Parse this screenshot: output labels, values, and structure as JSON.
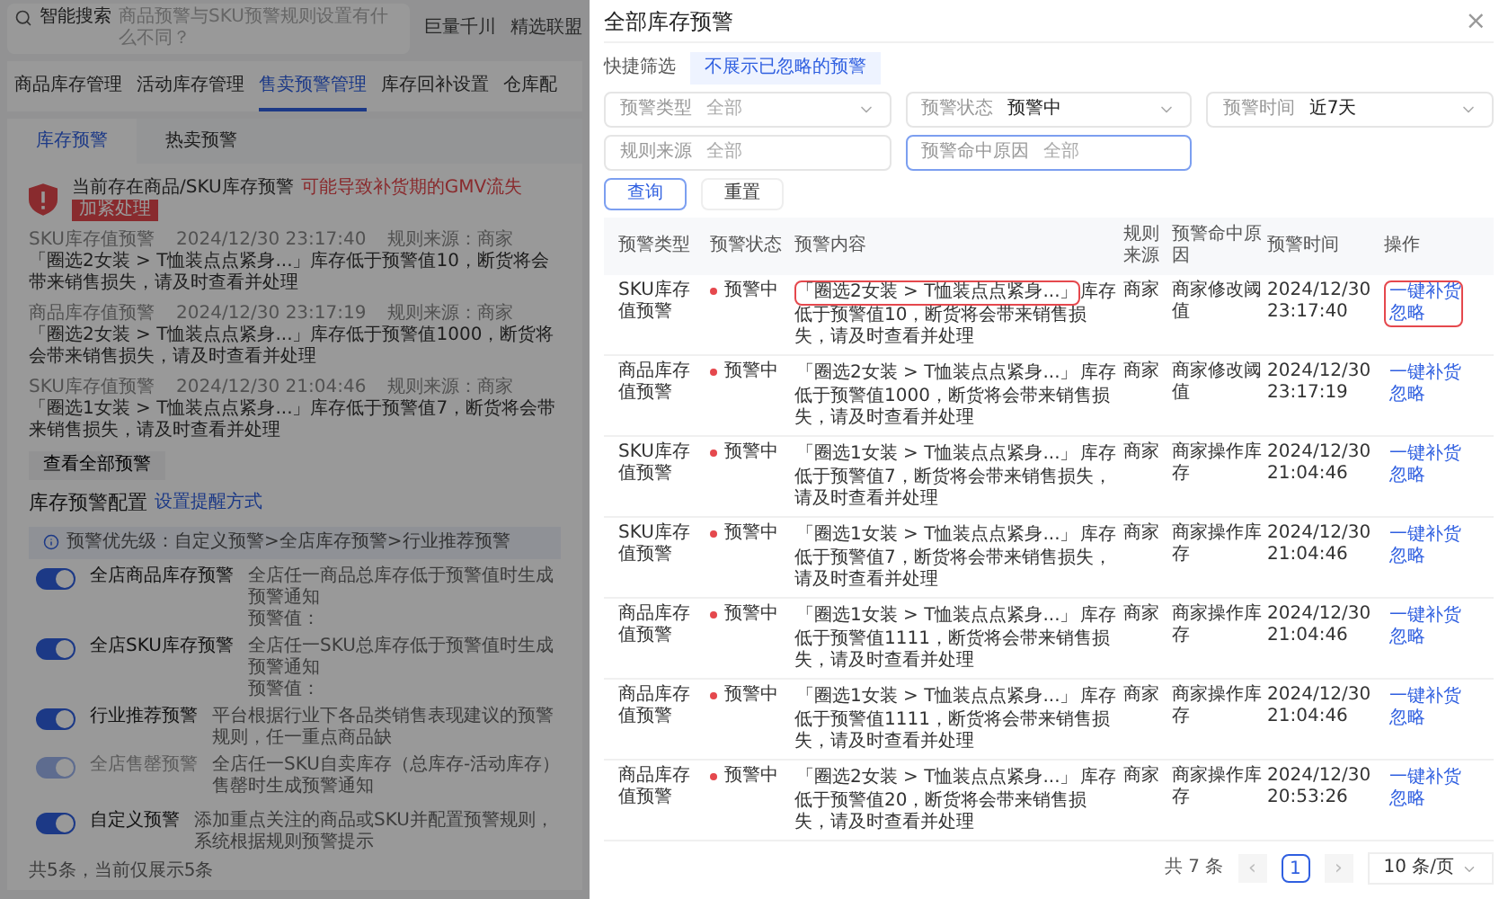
{
  "background": {
    "search": {
      "label": "智能搜索",
      "placeholder": "商品预警与SKU预警规则设置有什么不同？"
    },
    "top_links": [
      "巨量千川",
      "精选联盟"
    ],
    "tabs": [
      {
        "label": "商品库存管理",
        "selected": false
      },
      {
        "label": "活动库存管理",
        "selected": false
      },
      {
        "label": "售卖预警管理",
        "selected": true
      },
      {
        "label": "库存回补设置",
        "selected": false
      },
      {
        "label": "仓库配",
        "selected": false
      }
    ],
    "sub_tabs": [
      {
        "label": "库存预警",
        "selected": true
      },
      {
        "label": "热卖预警",
        "selected": false
      }
    ],
    "alert": {
      "title": "当前存在商品/SKU库存预警",
      "highlight": "可能导致补货期的GMV流失",
      "badge": "加紧处理"
    },
    "alerts": [
      {
        "type": "SKU库存值预警",
        "time": "2024/12/30 23:17:40",
        "source": "规则来源：商家",
        "text": "「圈选2女装 > T恤装点点紧身...」库存低于预警值10，断货将会带来销售损失，请及时查看并处理"
      },
      {
        "type": "商品库存值预警",
        "time": "2024/12/30 23:17:19",
        "source": "规则来源：商家",
        "text": "「圈选2女装 > T恤装点点紧身...」库存低于预警值1000，断货将会带来销售损失，请及时查看并处理"
      },
      {
        "type": "SKU库存值预警",
        "time": "2024/12/30 21:04:46",
        "source": "规则来源：商家",
        "text": "「圈选1女装 > T恤装点点紧身...」库存低于预警值7，断货将会带来销售损失，请及时查看并处理"
      }
    ],
    "view_all": "查看全部预警",
    "config": {
      "title": "库存预警配置",
      "link": "设置提醒方式",
      "notice": "预警优先级：自定义预警>全店库存预警>行业推荐预警"
    },
    "rules": [
      {
        "name": "全店商品库存预警",
        "desc": "全店任一商品总库存低于预警值时生成预警通知",
        "extra": "预警值：",
        "on": true,
        "disabled": false
      },
      {
        "name": "全店SKU库存预警",
        "desc": "全店任一SKU总库存低于预警值时生成预警通知",
        "extra": "预警值：",
        "on": true,
        "disabled": false
      },
      {
        "name": "行业推荐预警",
        "desc": "平台根据行业下各品类销售表现建议的预警规则，任一重点商品缺",
        "on": true,
        "disabled": false
      },
      {
        "name": "全店售罄预警",
        "desc": "全店任一SKU自卖库存（总库存-活动库存）售罄时生成预警通知",
        "on": true,
        "disabled": true
      },
      {
        "name": "自定义预警",
        "desc": "添加重点关注的商品或SKU并配置预警规则，系统根据规则预警提示",
        "on": true,
        "disabled": false
      }
    ],
    "footer": "共5条，当前仅展示5条"
  },
  "drawer": {
    "title": "全部库存预警",
    "close": "×",
    "quick_filter": {
      "label": "快捷筛选",
      "chip": "不展示已忽略的预警"
    },
    "filters": [
      {
        "label": "预警类型",
        "placeholder": "全部",
        "dropdown": true,
        "focused": false
      },
      {
        "label": "预警状态",
        "value": "预警中",
        "dropdown": true,
        "focused": false
      },
      {
        "label": "预警时间",
        "value": "近7天",
        "dropdown": true,
        "focused": false
      },
      {
        "label": "规则来源",
        "placeholder": "全部",
        "dropdown": false,
        "focused": false
      },
      {
        "label": "预警命中原因",
        "placeholder": "全部",
        "dropdown": false,
        "focused": true
      }
    ],
    "buttons": [
      {
        "label": "查询",
        "kind": "primary"
      },
      {
        "label": "重置",
        "kind": "default"
      }
    ],
    "table": {
      "columns": [
        "预警类型",
        "预警状态",
        "预警内容",
        "规则来源",
        "预警命中原因",
        "预警时间",
        "操作"
      ],
      "rows": [
        {
          "type": "SKU库存值预警",
          "status": "预警中",
          "product": "「圈选2女装 > T恤装点点紧身...」",
          "text": "库存低于预警值10，断货将会带来销售损失，请及时查看并处理",
          "source": "商家",
          "reason": "商家修改阈值",
          "date": "2024/12/30",
          "time": "23:17:40",
          "actions": [
            "一键补货",
            "忽略"
          ],
          "highlighted": true
        },
        {
          "type": "商品库存值预警",
          "status": "预警中",
          "product": "「圈选2女装 > T恤装点点紧身...」",
          "text": "库存低于预警值1000，断货将会带来销售损失，请及时查看并处理",
          "source": "商家",
          "reason": "商家修改阈值",
          "date": "2024/12/30",
          "time": "23:17:19",
          "actions": [
            "一键补货",
            "忽略"
          ],
          "highlighted": false
        },
        {
          "type": "SKU库存值预警",
          "status": "预警中",
          "product": "「圈选1女装 > T恤装点点紧身...」",
          "text": "库存低于预警值7，断货将会带来销售损失，请及时查看并处理",
          "source": "商家",
          "reason": "商家操作库存",
          "date": "2024/12/30",
          "time": "21:04:46",
          "actions": [
            "一键补货",
            "忽略"
          ],
          "highlighted": false
        },
        {
          "type": "SKU库存值预警",
          "status": "预警中",
          "product": "「圈选1女装 > T恤装点点紧身...」",
          "text": "库存低于预警值7，断货将会带来销售损失，请及时查看并处理",
          "source": "商家",
          "reason": "商家操作库存",
          "date": "2024/12/30",
          "time": "21:04:46",
          "actions": [
            "一键补货",
            "忽略"
          ],
          "highlighted": false
        },
        {
          "type": "商品库存值预警",
          "status": "预警中",
          "product": "「圈选1女装 > T恤装点点紧身...」",
          "text": "库存低于预警值1111，断货将会带来销售损失，请及时查看并处理",
          "source": "商家",
          "reason": "商家操作库存",
          "date": "2024/12/30",
          "time": "21:04:46",
          "actions": [
            "一键补货",
            "忽略"
          ],
          "highlighted": false
        },
        {
          "type": "商品库存值预警",
          "status": "预警中",
          "product": "「圈选1女装 > T恤装点点紧身...」",
          "text": "库存低于预警值1111，断货将会带来销售损失，请及时查看并处理",
          "source": "商家",
          "reason": "商家操作库存",
          "date": "2024/12/30",
          "time": "21:04:46",
          "actions": [
            "一键补货",
            "忽略"
          ],
          "highlighted": false
        },
        {
          "type": "商品库存值预警",
          "status": "预警中",
          "product": "「圈选2女装 > T恤装点点紧身...」",
          "text": "库存低于预警值20，断货将会带来销售损失，请及时查看并处理",
          "source": "商家",
          "reason": "商家操作库存",
          "date": "2024/12/30",
          "time": "20:53:26",
          "actions": [
            "一键补货",
            "忽略"
          ],
          "highlighted": false
        }
      ]
    },
    "pagination": {
      "total": "共 7 条",
      "prev": "‹",
      "pages": [
        {
          "label": "1",
          "selected": true
        }
      ],
      "next": "›",
      "page_size": "10 条/页"
    }
  }
}
